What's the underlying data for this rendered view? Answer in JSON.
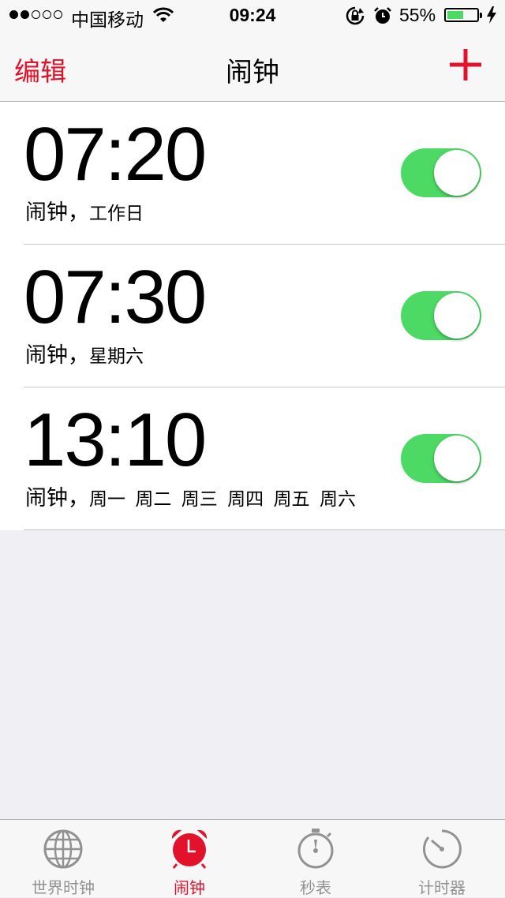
{
  "status_bar": {
    "carrier": "中国移动",
    "time": "09:24",
    "battery_percent": "55%",
    "battery_level": 0.55,
    "signal_strength": 2
  },
  "nav": {
    "edit_label": "编辑",
    "title": "闹钟"
  },
  "alarms": [
    {
      "time": "07:20",
      "label": "闹钟，",
      "repeat": "工作日",
      "enabled": true
    },
    {
      "time": "07:30",
      "label": "闹钟，",
      "repeat": "星期六",
      "enabled": true
    },
    {
      "time": "13:10",
      "label": "闹钟，",
      "repeat": "周一 周二 周三 周四 周五 周六",
      "enabled": true
    }
  ],
  "tabs": [
    {
      "label": "世界时钟",
      "icon": "globe-icon",
      "active": false
    },
    {
      "label": "闹钟",
      "icon": "alarm-clock-icon",
      "active": true
    },
    {
      "label": "秒表",
      "icon": "stopwatch-icon",
      "active": false
    },
    {
      "label": "计时器",
      "icon": "timer-icon",
      "active": false
    }
  ],
  "colors": {
    "accent": "#e1122a",
    "toggle_on": "#4cd964",
    "tab_inactive": "#929292"
  }
}
